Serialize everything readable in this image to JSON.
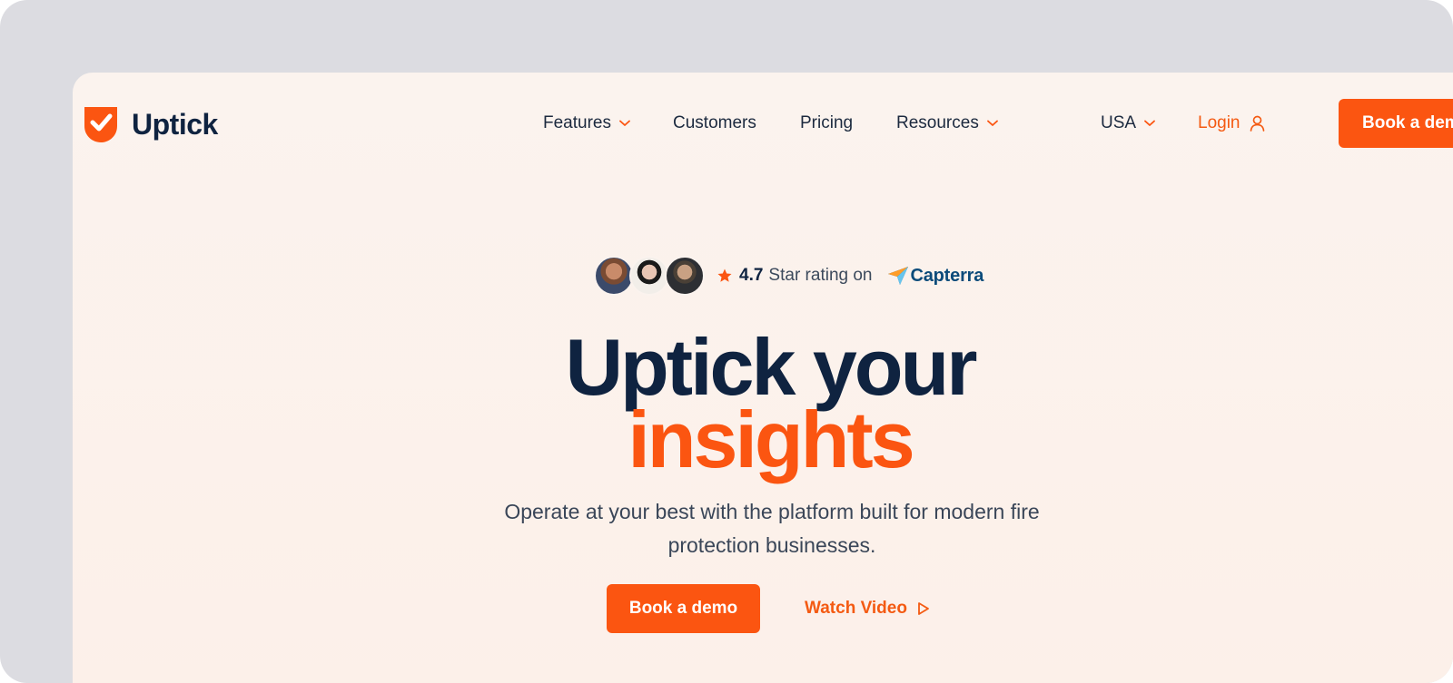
{
  "brand": {
    "name": "Uptick",
    "accent": "#fb5511",
    "navy": "#0f2340"
  },
  "nav": {
    "items": [
      {
        "label": "Features",
        "has_dropdown": true
      },
      {
        "label": "Customers",
        "has_dropdown": false
      },
      {
        "label": "Pricing",
        "has_dropdown": false
      },
      {
        "label": "Resources",
        "has_dropdown": true
      }
    ],
    "region": "USA",
    "login": "Login",
    "book_demo": "Book a demo"
  },
  "rating": {
    "value": "4.7",
    "text": "Star rating on",
    "platform": "Capterra",
    "avatar_count": 3
  },
  "hero": {
    "title_line1": "Uptick your",
    "title_line2": "insights",
    "subtitle": "Operate at your best with the platform built for modern fire protection businesses.",
    "primary_cta": "Book a demo",
    "secondary_cta": "Watch Video"
  },
  "icons": [
    "uptick-logo-icon",
    "chevron-down-icon",
    "user-icon",
    "star-icon",
    "capterra-logo-icon",
    "play-icon"
  ]
}
